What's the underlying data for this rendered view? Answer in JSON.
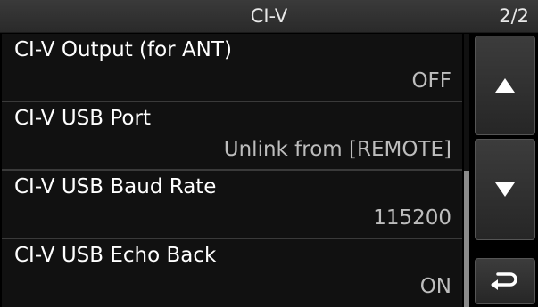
{
  "header": {
    "title": "CI-V",
    "page": "2/2"
  },
  "items": [
    {
      "label": "CI-V Output (for ANT)",
      "value": "OFF"
    },
    {
      "label": "CI-V USB Port",
      "value": "Unlink from [REMOTE]"
    },
    {
      "label": "CI-V USB Baud Rate",
      "value": "115200"
    },
    {
      "label": "CI-V USB Echo Back",
      "value": "ON"
    }
  ],
  "icons": {
    "scroll_up": "triangle-up-icon",
    "scroll_down": "triangle-down-icon",
    "back": "return-arrow-icon"
  },
  "colors": {
    "background": "#000000",
    "row_background": "#111111",
    "separator": "#3a3a3a",
    "label_text": "#ffffff",
    "value_text": "#bdbdbd",
    "button_face": "#333333"
  },
  "scroll": {
    "visible_fraction": 0.5,
    "position_fraction": 0.5
  }
}
